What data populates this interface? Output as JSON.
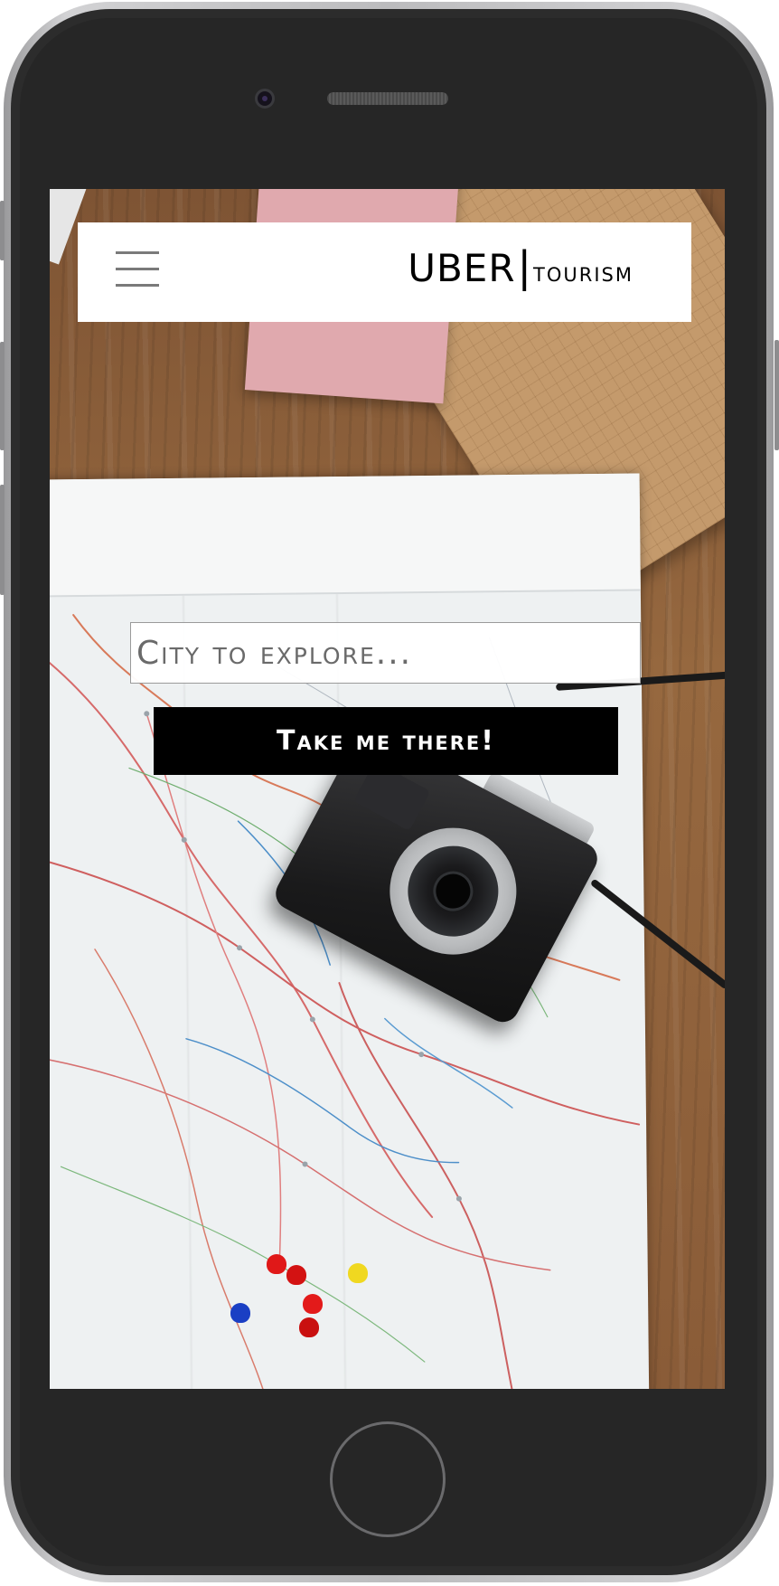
{
  "header": {
    "logo_main": "UBER",
    "logo_separator": "|",
    "logo_sub": "tourism",
    "menu_icon": "hamburger-menu-icon"
  },
  "search": {
    "placeholder": "City to explore...",
    "value": ""
  },
  "actions": {
    "submit_label": "Take me there!"
  },
  "colors": {
    "header_background": "#ffffff",
    "button_background": "#000000",
    "button_text": "#ffffff",
    "logo_text": "#000000",
    "menu_icon": "#7a7a7a"
  }
}
